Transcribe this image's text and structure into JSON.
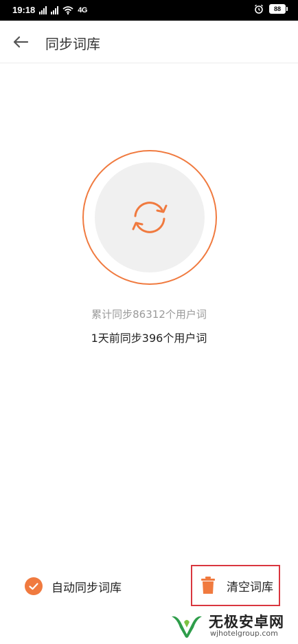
{
  "status_bar": {
    "time": "19:18",
    "net_badge": "4G",
    "battery": "88"
  },
  "header": {
    "title": "同步词库"
  },
  "sync": {
    "total_text": "累计同步86312个用户词",
    "recent_text": "1天前同步396个用户词"
  },
  "actions": {
    "auto_sync_label": "自动同步词库",
    "clear_label": "清空词库"
  },
  "watermark": {
    "title": "无极安卓网",
    "url": "wjhotelgroup.com"
  },
  "colors": {
    "accent": "#f07a3f",
    "highlight_box": "#d9363e",
    "inner_circle": "#f0f0f0"
  },
  "icons": {
    "back": "arrow-left-icon",
    "sync": "sync-arrows-icon",
    "check": "check-circle-icon",
    "trash": "trash-icon"
  }
}
